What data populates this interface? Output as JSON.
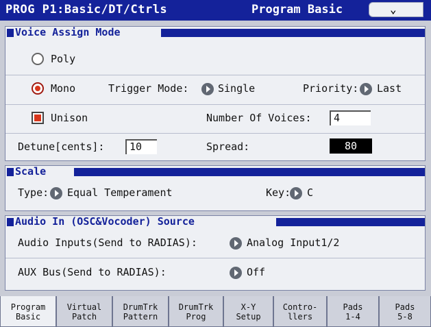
{
  "header": {
    "title": "PROG P1:Basic/DT/Ctrls",
    "page": "Program Basic"
  },
  "voice": {
    "heading": "Voice Assign Mode",
    "poly": "Poly",
    "mono": "Mono",
    "trigger_label": "Trigger Mode:",
    "trigger_value": "Single",
    "priority_label": "Priority:",
    "priority_value": "Last",
    "unison": "Unison",
    "voices_label": "Number Of Voices:",
    "voices_value": "4",
    "detune_label": "Detune[cents]:",
    "detune_value": "10",
    "spread_label": "Spread:",
    "spread_value": "80"
  },
  "scale": {
    "heading": "Scale",
    "type_label": "Type:",
    "type_value": "Equal Temperament",
    "key_label": "Key:",
    "key_value": "C"
  },
  "audio": {
    "heading": "Audio In (OSC&Vocoder) Source",
    "inputs_label": "Audio Inputs(Send to RADIAS):",
    "inputs_value": "Analog Input1/2",
    "aux_label": "AUX Bus(Send to RADIAS):",
    "aux_value": "Off"
  },
  "tabs": [
    {
      "l1": "Program",
      "l2": "Basic"
    },
    {
      "l1": "Virtual",
      "l2": "Patch"
    },
    {
      "l1": "DrumTrk",
      "l2": "Pattern"
    },
    {
      "l1": "DrumTrk",
      "l2": "Prog"
    },
    {
      "l1": "X-Y",
      "l2": "Setup"
    },
    {
      "l1": "Contro-",
      "l2": "llers"
    },
    {
      "l1": "Pads",
      "l2": "1-4"
    },
    {
      "l1": "Pads",
      "l2": "5-8"
    }
  ],
  "colors": {
    "header": "#14229a",
    "panel": "#eef0f4",
    "accent_red": "#d8361c"
  }
}
